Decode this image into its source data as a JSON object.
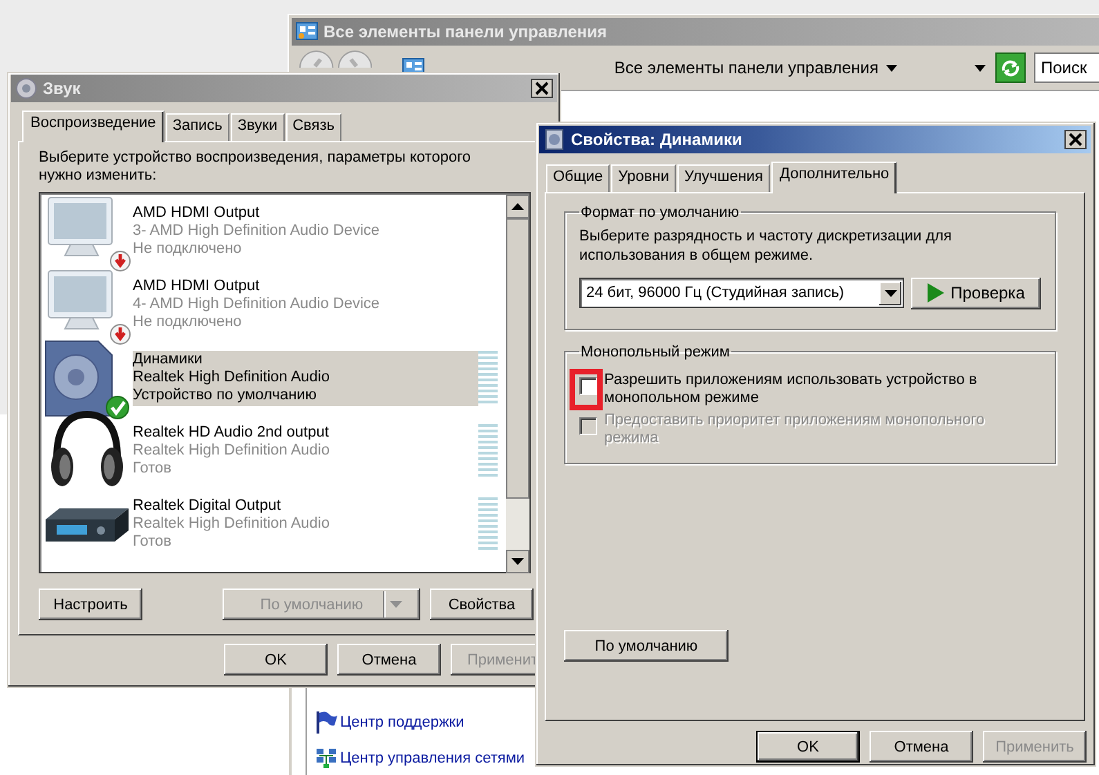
{
  "control_panel_window": {
    "title": "Все элементы панели управления",
    "breadcrumb": "Все элементы панели управления",
    "search": {
      "placeholder": "Поиск"
    },
    "links": [
      {
        "label": "Центр поддержки",
        "kind": "flag"
      },
      {
        "label": "Центр управления сетями",
        "kind": "network"
      }
    ]
  },
  "sound_dialog": {
    "title": "Звук",
    "tabs": [
      {
        "label": "Воспроизведение",
        "selected": true
      },
      {
        "label": "Запись",
        "selected": false
      },
      {
        "label": "Звуки",
        "selected": false
      },
      {
        "label": "Связь",
        "selected": false
      }
    ],
    "instruction": "Выберите устройство воспроизведения, параметры которого нужно изменить:",
    "devices": [
      {
        "name": "AMD HDMI Output",
        "description": "3- AMD High Definition Audio Device",
        "status": "Не подключено",
        "kind": "monitor",
        "connected": false,
        "is_default": false,
        "meter": false,
        "selected": false
      },
      {
        "name": "AMD HDMI Output",
        "description": "4- AMD High Definition Audio Device",
        "status": "Не подключено",
        "kind": "monitor",
        "connected": false,
        "is_default": false,
        "meter": false,
        "selected": false
      },
      {
        "name": "Динамики",
        "description": "Realtek High Definition Audio",
        "status": "Устройство по умолчанию",
        "kind": "speaker",
        "connected": true,
        "is_default": true,
        "meter": true,
        "selected": true
      },
      {
        "name": "Realtek HD Audio 2nd output",
        "description": "Realtek High Definition Audio",
        "status": "Готов",
        "kind": "headphones",
        "connected": true,
        "is_default": false,
        "meter": true,
        "selected": false
      },
      {
        "name": "Realtek Digital Output",
        "description": "Realtek High Definition Audio",
        "status": "Готов",
        "kind": "receiver",
        "connected": true,
        "is_default": false,
        "meter": true,
        "selected": false
      }
    ],
    "buttons": [
      {
        "label": "Настроить",
        "kind": "plain",
        "disabled": false
      },
      {
        "label": "По умолчанию",
        "kind": "split",
        "disabled": true
      },
      {
        "label": "Свойства",
        "kind": "plain",
        "disabled": false
      }
    ],
    "footer_buttons": [
      {
        "label": "OK",
        "disabled": false,
        "default": false
      },
      {
        "label": "Отмена",
        "disabled": false,
        "default": false
      },
      {
        "label": "Применит",
        "disabled": true,
        "default": false
      }
    ]
  },
  "properties_dialog": {
    "title": "Свойства: Динамики",
    "tabs": [
      {
        "label": "Общие",
        "selected": false
      },
      {
        "label": "Уровни",
        "selected": false
      },
      {
        "label": "Улучшения",
        "selected": false
      },
      {
        "label": "Дополнительно",
        "selected": true
      }
    ],
    "format_group": {
      "title": "Формат по умолчанию",
      "description": "Выберите разрядность и частоту дискретизации для использования в общем режиме.",
      "format": "24 бит, 96000 Гц (Студийная запись)",
      "test_button": "Проверка"
    },
    "exclusive_group": {
      "title": "Монопольный режим",
      "options": [
        {
          "label": "Разрешить приложениям использовать устройство в монопольном режиме",
          "checked": false,
          "disabled": false,
          "highlighted": true
        },
        {
          "label": "Предоставить приоритет приложениям монопольного режима",
          "checked": false,
          "disabled": true,
          "highlighted": false
        }
      ]
    },
    "restore_button": "По умолчанию",
    "footer_buttons": [
      {
        "label": "OK",
        "disabled": false,
        "default": true
      },
      {
        "label": "Отмена",
        "disabled": false,
        "default": false
      },
      {
        "label": "Применить",
        "disabled": true,
        "default": false
      }
    ]
  }
}
